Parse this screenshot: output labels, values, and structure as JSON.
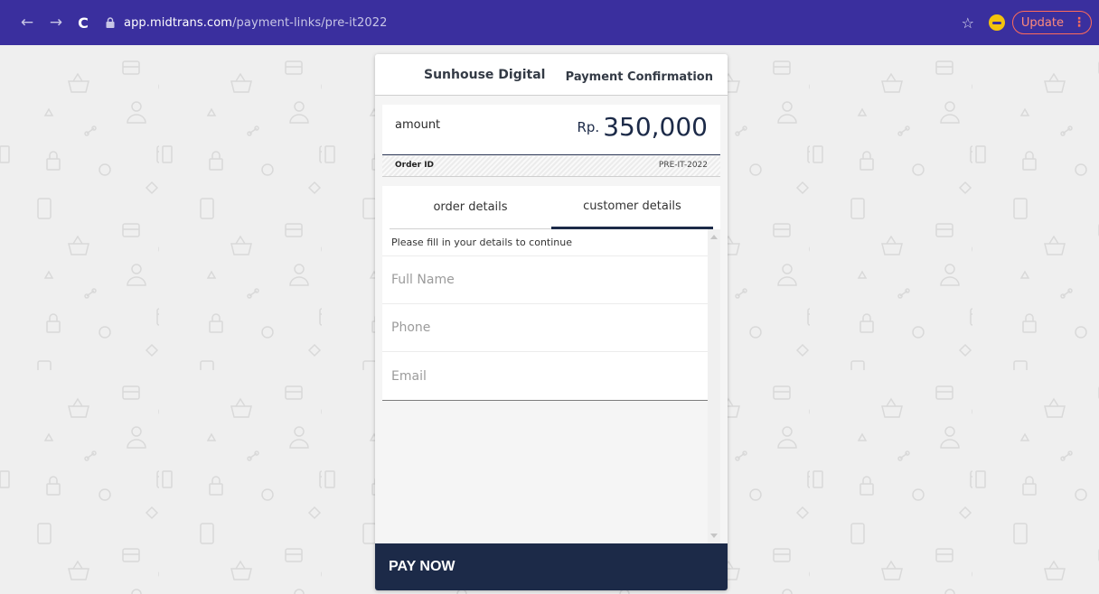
{
  "browser": {
    "url_host": "app.midtrans.com",
    "url_path": "/payment-links/pre-it2022",
    "update_label": "Update",
    "icons": [
      "back-arrow-icon",
      "forward-arrow-icon",
      "reload-icon",
      "lock-icon",
      "bookmark-star-icon",
      "extension-icon",
      "menu-dots-icon"
    ]
  },
  "header": {
    "merchant": "Sunhouse Digital",
    "title": "Payment Confirmation"
  },
  "amount": {
    "label": "amount",
    "currency": "Rp.",
    "value": "350,000"
  },
  "order": {
    "label": "Order ID",
    "value": "PRE-IT-2022"
  },
  "tabs": [
    {
      "label": "order details",
      "active": false
    },
    {
      "label": "customer details",
      "active": true
    }
  ],
  "form": {
    "hint": "Please fill in your details to continue",
    "fields": [
      {
        "placeholder": "Full Name",
        "value": ""
      },
      {
        "placeholder": "Phone",
        "value": ""
      },
      {
        "placeholder": "Email",
        "value": ""
      }
    ]
  },
  "pay_button": "PAY NOW",
  "colors": {
    "chrome": "#3a2f9e",
    "accent_navy": "#1c2a48",
    "background": "#efefef",
    "update_red": "#ff6b5a"
  }
}
